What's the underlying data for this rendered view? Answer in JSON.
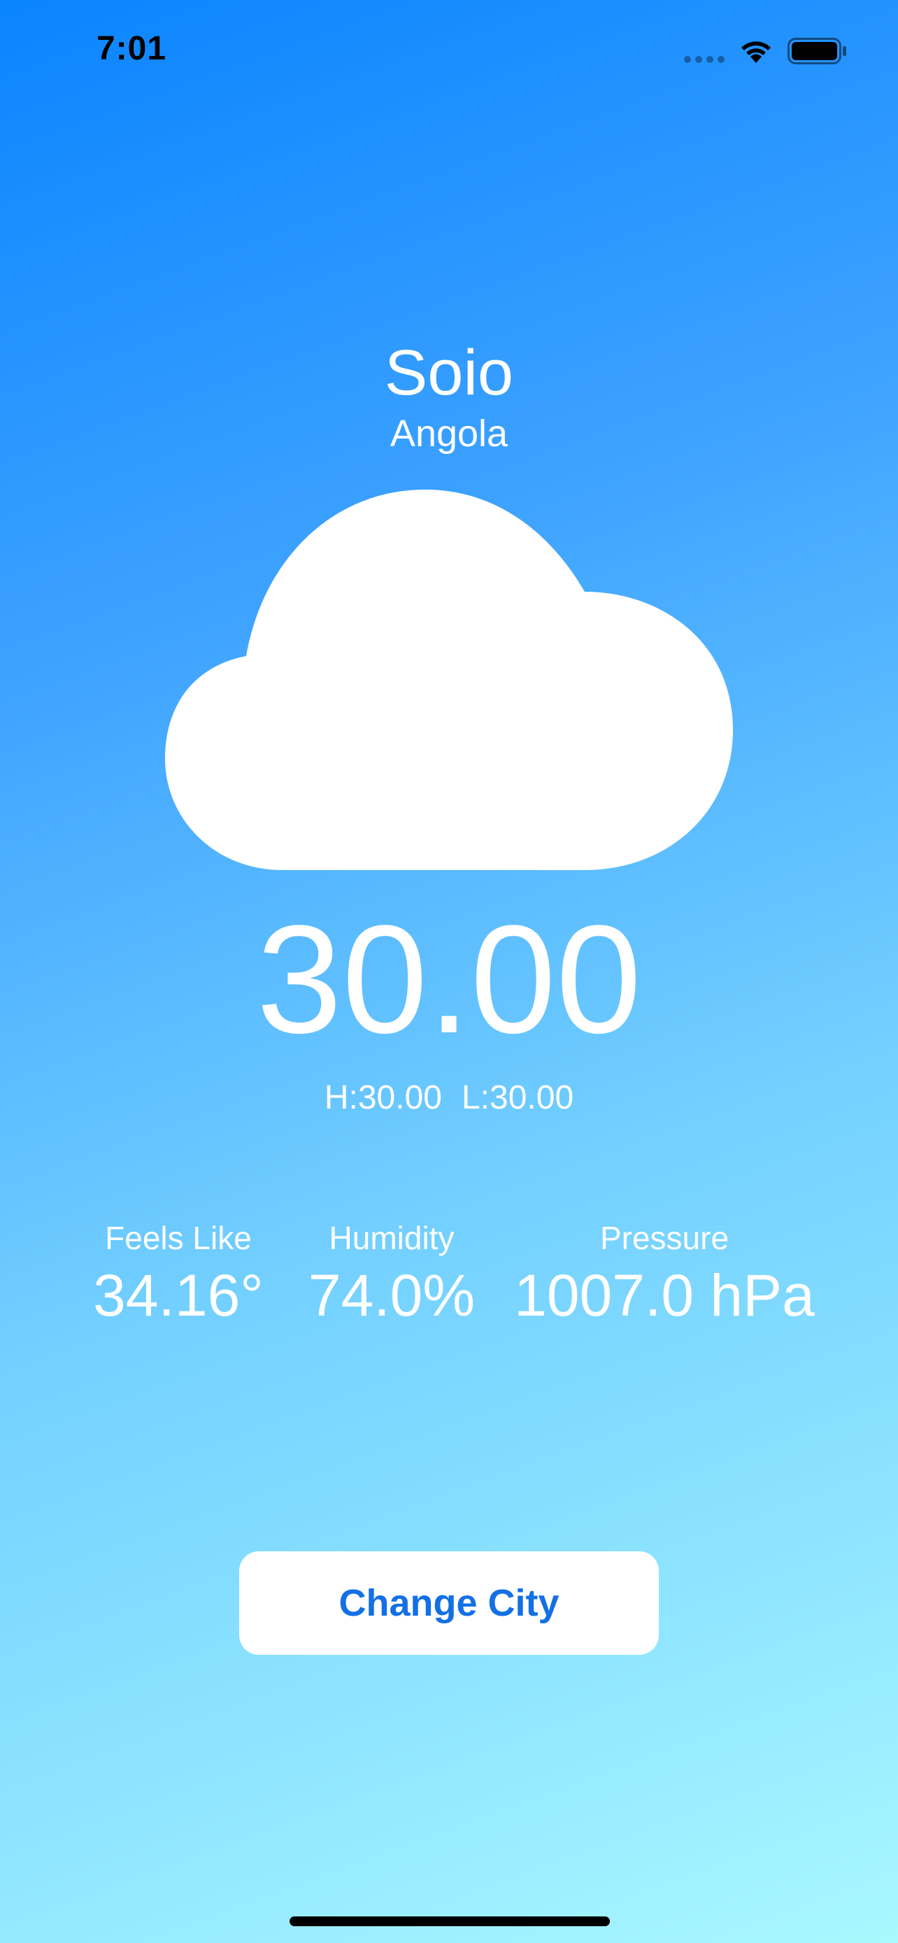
{
  "status_bar": {
    "time": "7:01"
  },
  "location": {
    "city": "Soio",
    "country": "Angola"
  },
  "weather": {
    "icon": "cloud-icon",
    "temperature": "30.00",
    "high": "H:30.00",
    "low": "L:30.00"
  },
  "stats": {
    "feels_like": {
      "label": "Feels Like",
      "value": "34.16°"
    },
    "humidity": {
      "label": "Humidity",
      "value": "74.0%"
    },
    "pressure": {
      "label": "Pressure",
      "value": "1007.0 hPa"
    }
  },
  "actions": {
    "change_city_label": "Change City"
  },
  "colors": {
    "gradient_top": "#0A84FF",
    "gradient_bottom": "#A8F8FF",
    "button_text": "#1370E5",
    "button_background": "#FFFFFF"
  }
}
